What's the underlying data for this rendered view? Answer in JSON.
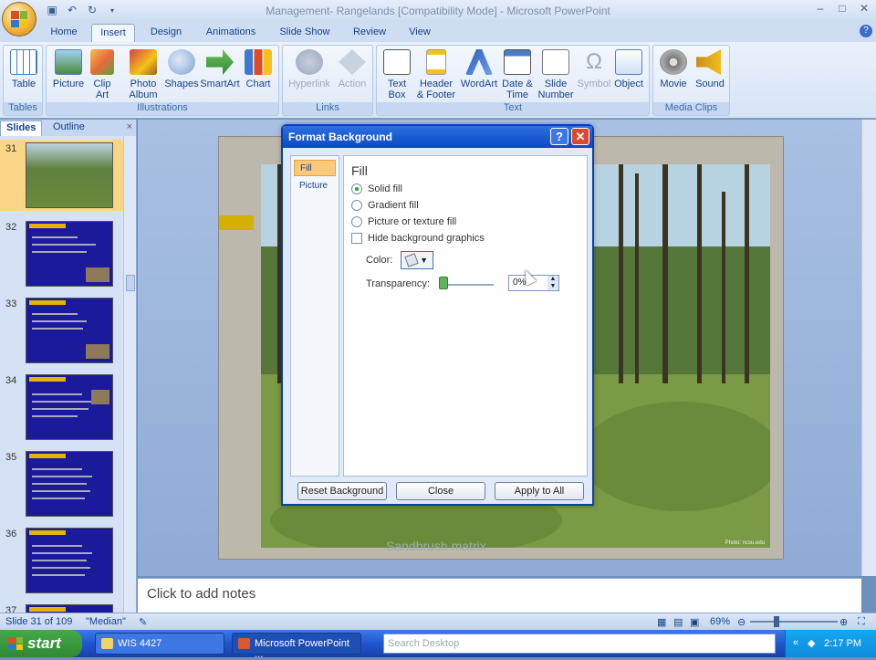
{
  "window": {
    "title": "Management- Rangelands [Compatibility Mode] - Microsoft PowerPoint",
    "controls": [
      "–",
      "□",
      "✕"
    ]
  },
  "quick_access": [
    "save",
    "undo",
    "redo"
  ],
  "tabs": [
    {
      "label": "Home",
      "active": false
    },
    {
      "label": "Insert",
      "active": true
    },
    {
      "label": "Design",
      "active": false
    },
    {
      "label": "Animations",
      "active": false
    },
    {
      "label": "Slide Show",
      "active": false
    },
    {
      "label": "Review",
      "active": false
    },
    {
      "label": "View",
      "active": false
    }
  ],
  "ribbon": {
    "groups": [
      {
        "label": "Tables",
        "buttons": [
          {
            "label": "Table"
          }
        ]
      },
      {
        "label": "Illustrations",
        "buttons": [
          {
            "label": "Picture"
          },
          {
            "label": "Clip Art"
          },
          {
            "label": "Photo Album"
          },
          {
            "label": "Shapes"
          },
          {
            "label": "SmartArt"
          },
          {
            "label": "Chart"
          }
        ]
      },
      {
        "label": "Links",
        "buttons": [
          {
            "label": "Hyperlink"
          },
          {
            "label": "Action"
          }
        ]
      },
      {
        "label": "Text",
        "buttons": [
          {
            "label": "Text Box"
          },
          {
            "label": "Header & Footer"
          },
          {
            "label": "WordArt"
          },
          {
            "label": "Date & Time"
          },
          {
            "label": "Slide Number"
          },
          {
            "label": "Symbol"
          },
          {
            "label": "Object"
          }
        ]
      },
      {
        "label": "Media Clips",
        "buttons": [
          {
            "label": "Movie"
          },
          {
            "label": "Sound"
          }
        ]
      }
    ]
  },
  "left_pane": {
    "tabs": [
      "Slides",
      "Outline"
    ],
    "close": "×",
    "slides": [
      {
        "number": "31",
        "selected": true
      },
      {
        "number": "32",
        "selected": false,
        "title": "RANGELANDS"
      },
      {
        "number": "33",
        "selected": false,
        "title": "RANGELANDS"
      },
      {
        "number": "34",
        "selected": false,
        "title": "RANGELANDS"
      },
      {
        "number": "35",
        "selected": false,
        "title": "RANGELANDS"
      },
      {
        "number": "36",
        "selected": false,
        "title": "RANGELANDS"
      },
      {
        "number": "37",
        "selected": false
      }
    ]
  },
  "slide": {
    "caption": "Sandbrush matrix",
    "credit": "Photo: ncsu.edu"
  },
  "notes": {
    "placeholder": "Click to add notes"
  },
  "status_bar": {
    "slide_info": "Slide 31 of 109",
    "theme": "\"Median\"",
    "zoom": "69%"
  },
  "taskbar": {
    "start": "start",
    "buttons": [
      "WIS 4427",
      "Microsoft PowerPoint ..."
    ],
    "search_placeholder": "Search Desktop",
    "clock": "2:17 PM"
  },
  "dialog": {
    "title": "Format Background",
    "nav": [
      "Fill",
      "Picture"
    ],
    "section": "Fill",
    "options": [
      {
        "label": "Solid fill",
        "selected": true
      },
      {
        "label": "Gradient fill",
        "selected": false
      },
      {
        "label": "Picture or texture fill",
        "selected": false
      }
    ],
    "hide_bg": {
      "label": "Hide background graphics",
      "checked": false
    },
    "color_label": "Color:",
    "transparency_label": "Transparency:",
    "transparency_value": "0%",
    "transparency_level": 0,
    "buttons": {
      "reset": "Reset Background",
      "close": "Close",
      "apply_all": "Apply to All"
    }
  },
  "colors": {
    "ribbon_text": "#15428b",
    "selected_slide": "#fbd686",
    "dialog_title": "#0a49c6",
    "thumb_bg": "#1a1a9a",
    "thumb_title": "#e3b500"
  }
}
